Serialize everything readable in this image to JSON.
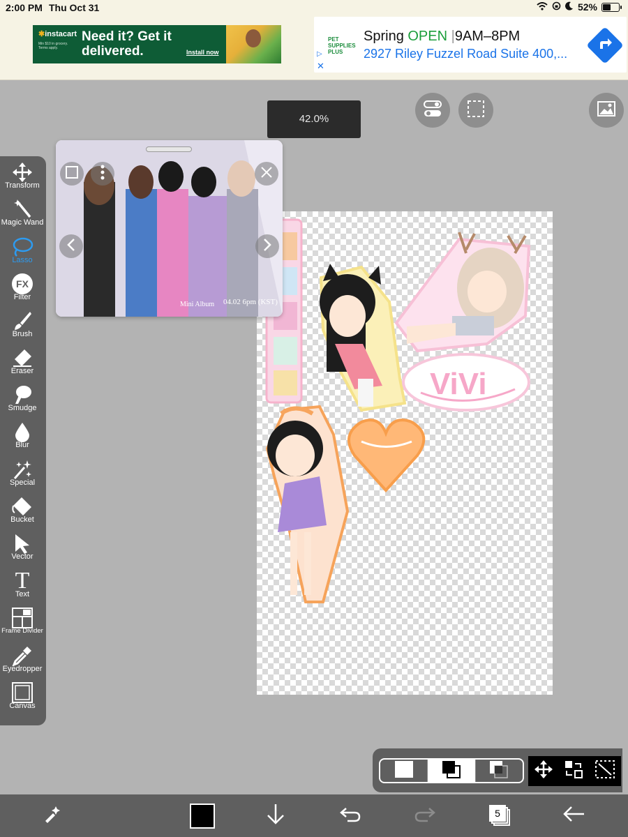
{
  "status_bar": {
    "time": "2:00 PM",
    "date": "Thu Oct 31",
    "battery": "52%",
    "battery_level": 0.52
  },
  "ads": {
    "instacart": {
      "brand": "instacart",
      "fine_print": "Min $10 in grocery. Terms apply.",
      "headline": "Need it? Get it delivered.",
      "cta": "Install now"
    },
    "pet_supplies": {
      "logo_text": "PET SUPPLIES PLUS",
      "store": "Spring",
      "status": "OPEN",
      "separator": "|",
      "hours": "9AM–8PM",
      "address": "2927 Riley Fuzzel Road Suite 400,...",
      "ad_choices": "▷",
      "close": "✕"
    }
  },
  "zoom_level": "42.0%",
  "top_buttons": [
    "toggle-icon",
    "selection-icon",
    "image-icon"
  ],
  "tools": [
    {
      "label": "Transform",
      "icon": "transform-icon",
      "active": false
    },
    {
      "label": "Magic Wand",
      "icon": "magic-wand-icon",
      "active": false
    },
    {
      "label": "Lasso",
      "icon": "lasso-icon",
      "active": true
    },
    {
      "label": "Filter",
      "icon": "filter-icon",
      "active": false
    },
    {
      "label": "Brush",
      "icon": "brush-icon",
      "active": false
    },
    {
      "label": "Eraser",
      "icon": "eraser-icon",
      "active": false
    },
    {
      "label": "Smudge",
      "icon": "smudge-icon",
      "active": false
    },
    {
      "label": "Blur",
      "icon": "blur-icon",
      "active": false
    },
    {
      "label": "Special",
      "icon": "special-icon",
      "active": false
    },
    {
      "label": "Bucket",
      "icon": "bucket-icon",
      "active": false
    },
    {
      "label": "Vector",
      "icon": "vector-icon",
      "active": false
    },
    {
      "label": "Text",
      "icon": "text-icon",
      "active": false
    },
    {
      "label": "Frame Divider",
      "icon": "frame-divider-icon",
      "active": false
    },
    {
      "label": "Eyedropper",
      "icon": "eyedropper-icon",
      "active": false
    },
    {
      "label": "Canvas",
      "icon": "canvas-icon",
      "active": false
    }
  ],
  "reference_window": {
    "caption_date": "04.02 6pm (KST)",
    "caption_album": "Mini Album"
  },
  "filter_icon_text": "FX",
  "text_icon_glyph": "T",
  "layer_count": "5",
  "colors": {
    "accent": "#2d9bf0",
    "panel": "#5f5f5f",
    "background": "#b3b3b3",
    "primary_color": "#000000"
  },
  "bottom_toolbar": [
    "quick-menu-icon",
    "color-swatch",
    "download-icon",
    "undo-icon",
    "redo-icon",
    "layers-icon",
    "back-arrow-icon"
  ]
}
